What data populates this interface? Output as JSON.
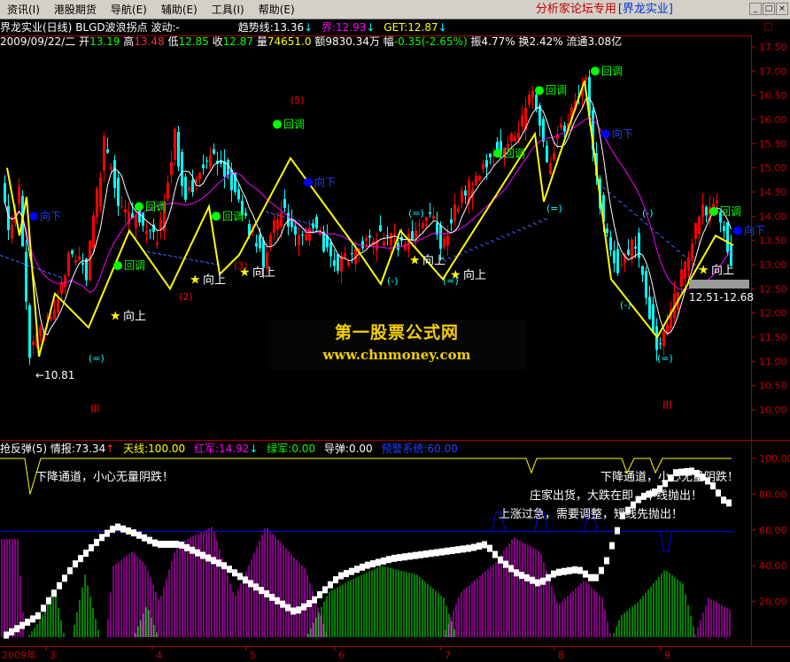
{
  "menubar": {
    "items": [
      "资讯(I)",
      "港股期货",
      "导航(E)",
      "辅助(E)",
      "工具(I)",
      "帮助(E)"
    ],
    "forum_text": "分析家论坛专用",
    "forum_link": "[界龙实业]"
  },
  "window_buttons": [
    "_",
    "□",
    "×"
  ],
  "info_line1": {
    "stock": "界龙实业(日线)",
    "indicator": "BLGD波浪拐点",
    "wave": "波动:-",
    "trend_label": "趋势线:",
    "trend_value": "13.36",
    "trend_arrow": "↓",
    "jie_label": "界:",
    "jie_value": "12.93",
    "jie_arrow": "↓",
    "get_label": "GET:",
    "get_value": "12.87",
    "get_arrow": "↓"
  },
  "info_line2": {
    "date": "2009/09/22/二",
    "open_label": "开",
    "open": "13.19",
    "high_label": "高",
    "high": "13.48",
    "low_label": "低",
    "low": "12.85",
    "close_label": "收",
    "close": "12.87",
    "vol_label": "量",
    "vol": "74651.0",
    "amt_label": "额",
    "amt": "9830.34万",
    "chg_label": "幅",
    "chg": "-0.35(-2.65%)",
    "amp_label": "振",
    "amp": "4.77%",
    "turn_label": "换",
    "turn": "2.42%",
    "float_label": "流通",
    "float": "3.08亿"
  },
  "close_panel": "□",
  "price_axis": {
    "ticks": [
      "17.50",
      "17.00",
      "16.50",
      "16.00",
      "15.50",
      "15.00",
      "14.50",
      "14.00",
      "13.50",
      "13.00",
      "12.50",
      "12.00",
      "11.50",
      "11.00",
      "10.50",
      "10.00"
    ],
    "min": 10.0,
    "max": 17.5
  },
  "watermark": {
    "line1": "第一股票公式网",
    "line2": "www.chnmoney.com"
  },
  "current_range": "12.51-12.68",
  "main_labels": {
    "low_value": "←10.81",
    "hui_tiao": "回调",
    "xiang_shang": "向上",
    "xiang_xia": "向下",
    "bracket_neg": "(-)",
    "bracket_eq": "(=)",
    "bracket_five": "(5)",
    "bracket_two": "(2)",
    "bracket_three": "(3)",
    "roman_three": "III"
  },
  "sub_legend": {
    "name": "抢反弹(5)",
    "qingbao_label": "情报:",
    "qingbao": "73.34",
    "qingbao_arrow": "↑",
    "tianxian_label": "天线:",
    "tianxian": "100.00",
    "hongjun_label": "红军:",
    "hongjun": "14.92",
    "hongjun_arrow": "↓",
    "lvjun_label": "绿军:",
    "lvjun": "0.00",
    "daodan_label": "导弹:",
    "daodan": "0.00",
    "yujing_label": "预警系统:",
    "yujing": "60.00"
  },
  "sub_axis": {
    "ticks": [
      "100.00",
      "80.00",
      "60.00",
      "40.00",
      "20.00"
    ]
  },
  "sub_annotations": {
    "a1": "下降通道，小心无量阴跌！",
    "a2": "下降通道，小心无量阴跌！",
    "a3": "庄家出货，大跌在即，中线抛出！",
    "a4": "上涨过急，需要调整，短线先抛出！"
  },
  "x_axis": {
    "year": "2009年",
    "months": [
      "3",
      "4",
      "5",
      "6",
      "7",
      "8",
      "9"
    ]
  },
  "colors": {
    "up": "#ff0000",
    "down": "#00ffff",
    "wave": "#ffff00",
    "ma": "#ff00ff",
    "ma2": "#ffffff",
    "trend": "#4060ff",
    "green_dot": "#00ff00",
    "blue_dot": "#0000ff",
    "qingbao": "#ffffff",
    "tianxian": "#ffff00",
    "hongjun": "#ff00ff",
    "lvjun": "#00ff00",
    "yujing": "#0000ff"
  }
}
